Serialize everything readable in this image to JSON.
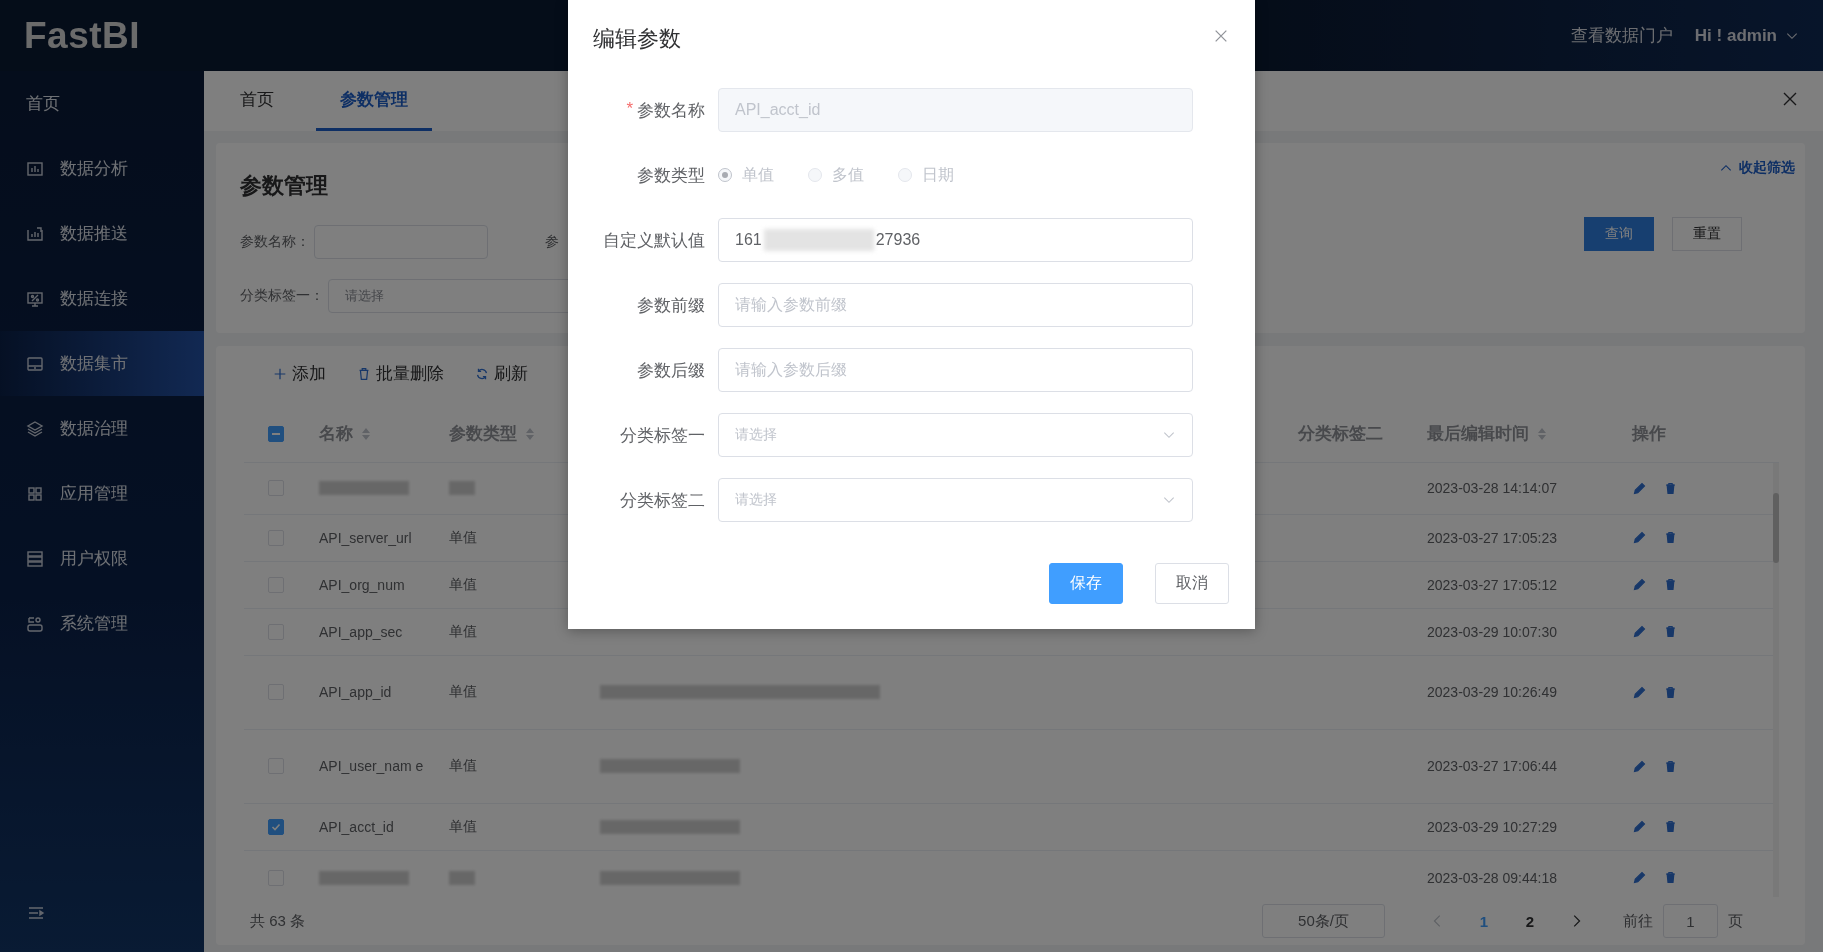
{
  "header": {
    "logo": "FastBI",
    "portal_link": "查看数据门户",
    "user": "Hi ! admin"
  },
  "sidebar": {
    "items": [
      {
        "label": "首页",
        "selected": false
      },
      {
        "label": "数据分析",
        "selected": false
      },
      {
        "label": "数据推送",
        "selected": false
      },
      {
        "label": "数据连接",
        "selected": false
      },
      {
        "label": "数据集市",
        "selected": true
      },
      {
        "label": "数据治理",
        "selected": false
      },
      {
        "label": "应用管理",
        "selected": false
      },
      {
        "label": "用户权限",
        "selected": false
      },
      {
        "label": "系统管理",
        "selected": false
      }
    ]
  },
  "tabs": [
    {
      "label": "首页",
      "selected": false
    },
    {
      "label": "参数管理",
      "selected": true
    }
  ],
  "filter": {
    "title": "参数管理",
    "collapse_link": "收起筛选",
    "rows": [
      [
        {
          "kind": "input",
          "label": "参数名称："
        },
        {
          "kind": "label",
          "label": "参"
        }
      ],
      [
        {
          "kind": "select",
          "label": "分类标签一：",
          "placeholder": "请选择"
        }
      ]
    ],
    "buttons": [
      {
        "label": "查询",
        "primary": true
      },
      {
        "label": "重置",
        "primary": false
      }
    ]
  },
  "table": {
    "toolbar": [
      "添加",
      "批量删除",
      "刷新"
    ],
    "select_all": {
      "indeterminate": true
    },
    "columns": [
      {
        "label": "名称",
        "sortable": true
      },
      {
        "label": "参数类型",
        "sortable": true
      },
      {
        "label": "分类标签二",
        "sortable": false
      },
      {
        "label": "最后编辑时间",
        "sortable": true
      },
      {
        "label": "操作",
        "sortable": false
      }
    ],
    "rows": [
      {
        "checked": false,
        "value_redacted": false,
        "time": "2023-03-28 14:14:07"
      },
      {
        "checked": false,
        "name": "API_server_url",
        "type": "单值",
        "value_redacted": false,
        "time": "2023-03-27 17:05:23"
      },
      {
        "checked": false,
        "name": "API_org_num",
        "type": "单值",
        "value_redacted": false,
        "time": "2023-03-27 17:05:12"
      },
      {
        "checked": false,
        "name": "API_app_sec",
        "type": "单值",
        "value_redacted": false,
        "time": "2023-03-29 10:07:30"
      },
      {
        "checked": false,
        "name": "API_app_id",
        "type": "单值",
        "value_redacted": true,
        "time": "2023-03-29 10:26:49"
      },
      {
        "checked": false,
        "name": "API_user_nam e",
        "type": "单值",
        "value_redacted": true,
        "time": "2023-03-27 17:06:44"
      },
      {
        "checked": true,
        "name": "API_acct_id",
        "type": "单值",
        "value_redacted": true,
        "time": "2023-03-29 10:27:29"
      },
      {
        "checked": false,
        "value_redacted": true,
        "time": "2023-03-28 09:44:18"
      }
    ]
  },
  "footer": {
    "total": "共 63 条",
    "page_size": "50条/页",
    "pages": [
      {
        "label": "1",
        "selected": true
      },
      {
        "label": "2",
        "selected": false
      }
    ],
    "goto_label": "前往",
    "goto_value": "1",
    "page_unit": "页"
  },
  "dialog": {
    "title": "编辑参数",
    "fields": [
      {
        "kind": "input",
        "label": "参数名称",
        "required_mark": "*",
        "disabled": true,
        "value": "API_acct_id"
      },
      {
        "kind": "radio",
        "label": "参数类型",
        "disabled": true,
        "options": [
          {
            "label": "单值",
            "selected": true
          },
          {
            "label": "多值",
            "selected": false
          },
          {
            "label": "日期",
            "selected": false
          }
        ]
      },
      {
        "kind": "input",
        "label": "自定义默认值",
        "value_parts": [
          "161",
          "27936"
        ]
      },
      {
        "kind": "input",
        "label": "参数前缀",
        "placeholder": "请输入参数前缀"
      },
      {
        "kind": "input",
        "label": "参数后缀",
        "placeholder": "请输入参数后缀"
      },
      {
        "kind": "select",
        "label": "分类标签一",
        "placeholder": "请选择"
      },
      {
        "kind": "select",
        "label": "分类标签二",
        "placeholder": "请选择"
      }
    ],
    "buttons": [
      {
        "label": "保存",
        "primary": true
      },
      {
        "label": "取消",
        "primary": false
      }
    ]
  }
}
